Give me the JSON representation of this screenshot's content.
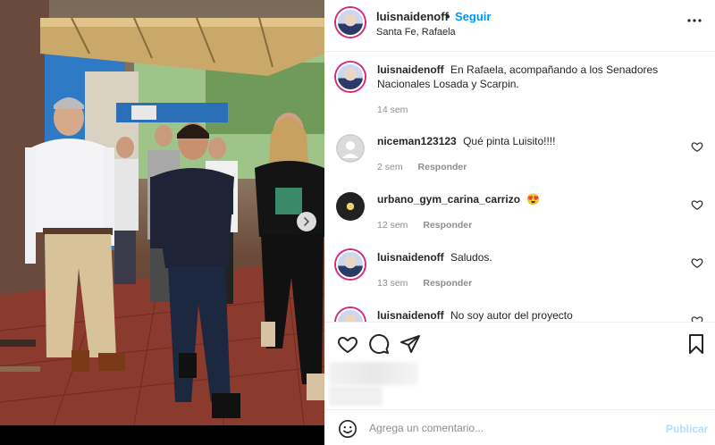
{
  "post": {
    "username": "luisnaidenoff",
    "separator": "•",
    "follow_label": "Seguir",
    "location": "Santa Fe, Rafaela",
    "more_icon": "more-options-icon"
  },
  "comments": [
    {
      "username": "luisnaidenoff",
      "text": "En Rafaela, acompañando a los Senadores Nacionales Losada y Scarpin.",
      "time": "14 sem",
      "reply": ""
    },
    {
      "username": "niceman123123",
      "text": "Qué pinta Luisito!!!!",
      "time": "2 sem",
      "reply": "Responder"
    },
    {
      "username": "urbano_gym_carina_carrizo",
      "text": "😍",
      "time": "12 sem",
      "reply": "Responder"
    },
    {
      "username": "luisnaidenoff",
      "text": "Saludos.",
      "time": "13 sem",
      "reply": "Responder"
    },
    {
      "username": "luisnaidenoff",
      "text": "No soy autor del proyecto",
      "time": "",
      "reply": ""
    }
  ],
  "composer": {
    "placeholder": "Agrega un comentario...",
    "publish_label": "Publicar"
  },
  "colors": {
    "accent": "#0095f6",
    "publish_disabled": "#b2dffc",
    "story_ring": "#d62976"
  }
}
